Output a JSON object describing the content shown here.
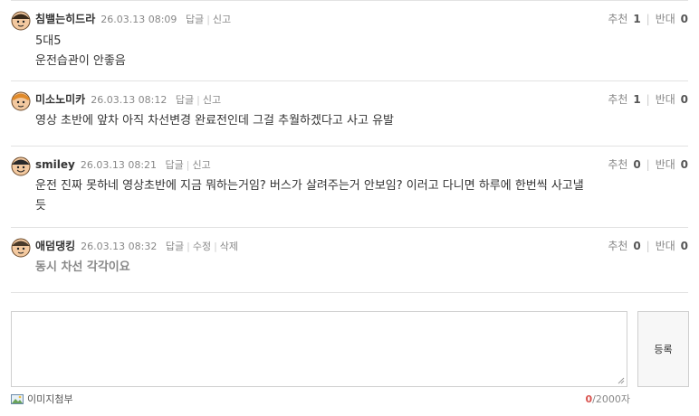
{
  "comments": [
    {
      "nickname": "침밸는히드라",
      "date": "26.03.13 08:09",
      "reply": "답글",
      "report": "신고",
      "recommend_label": "추천",
      "recommend": "1",
      "oppose_label": "반대",
      "oppose": "0",
      "lines": [
        "5대5",
        "운전습관이 안좋음"
      ]
    },
    {
      "nickname": "미소노미카",
      "date": "26.03.13 08:12",
      "reply": "답글",
      "report": "신고",
      "recommend_label": "추천",
      "recommend": "1",
      "oppose_label": "반대",
      "oppose": "0",
      "lines": [
        "영상 초반에 앞차 아직 차선변경 완료전인데 그걸 추월하겠다고 사고 유발"
      ]
    },
    {
      "nickname": "smiley",
      "date": "26.03.13 08:21",
      "reply": "답글",
      "report": "신고",
      "recommend_label": "추천",
      "recommend": "0",
      "oppose_label": "반대",
      "oppose": "0",
      "lines": [
        "운전 진짜 못하네 영상초반에 지금 뭐하는거임? 버스가 살려주는거 안보임? 이러고 다니면 하루에 한번씩 사고낼",
        "듯"
      ]
    },
    {
      "nickname": "애덤댕킹",
      "date": "26.03.13 08:32",
      "reply": "답글",
      "edit": "수정",
      "delete": "삭제",
      "recommend_label": "추천",
      "recommend": "0",
      "oppose_label": "반대",
      "oppose": "0",
      "lines": [
        "동시 차선 각각이요"
      ]
    }
  ],
  "form": {
    "submit_label": "등록",
    "attach_label": "이미지첨부",
    "count_current": "0",
    "count_max": "/2000자"
  },
  "colors": {
    "border": "#e2e2e2",
    "counter_accent": "#d9534f"
  }
}
